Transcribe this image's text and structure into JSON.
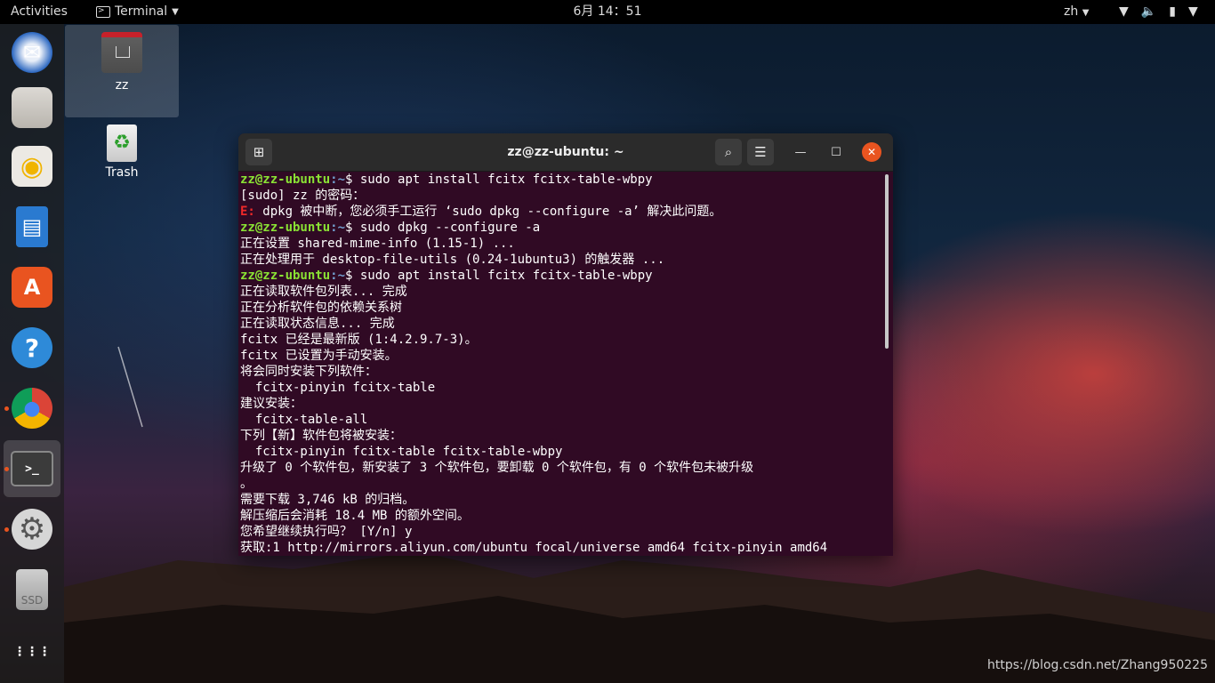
{
  "topbar": {
    "activities": "Activities",
    "app_menu": "Terminal",
    "clock": "6月 14：51",
    "language": "zh"
  },
  "desktop": {
    "home_label": "zz",
    "trash_label": "Trash"
  },
  "dock": {
    "items": [
      {
        "name": "thunderbird",
        "glyph": "✉"
      },
      {
        "name": "files",
        "glyph": ""
      },
      {
        "name": "rhythmbox",
        "glyph": "◉"
      },
      {
        "name": "writer",
        "glyph": "▤"
      },
      {
        "name": "software",
        "glyph": "A"
      },
      {
        "name": "help",
        "glyph": "?"
      },
      {
        "name": "chrome",
        "glyph": "●"
      },
      {
        "name": "terminal",
        "glyph": ">_"
      },
      {
        "name": "settings",
        "glyph": "⚙"
      },
      {
        "name": "ssd",
        "glyph": "SSD"
      },
      {
        "name": "app-grid",
        "glyph": "⋮⋮⋮"
      }
    ]
  },
  "terminal": {
    "title": "zz@zz-ubuntu: ~",
    "lines": [
      {
        "kind": "prompt",
        "user": "zz@zz-ubuntu",
        "path": ":~",
        "cmd": "$ sudo apt install fcitx fcitx-table-wbpy"
      },
      {
        "kind": "text",
        "text": "[sudo] zz 的密码："
      },
      {
        "kind": "error",
        "label": "E:",
        "text": " dpkg 被中断，您必须手工运行 ‘sudo dpkg --configure -a’ 解决此问题。"
      },
      {
        "kind": "prompt",
        "user": "zz@zz-ubuntu",
        "path": ":~",
        "cmd": "$ sudo dpkg --configure -a"
      },
      {
        "kind": "text",
        "text": "正在设置 shared-mime-info (1.15-1) ..."
      },
      {
        "kind": "text",
        "text": "正在处理用于 desktop-file-utils (0.24-1ubuntu3) 的触发器 ..."
      },
      {
        "kind": "prompt",
        "user": "zz@zz-ubuntu",
        "path": ":~",
        "cmd": "$ sudo apt install fcitx fcitx-table-wbpy"
      },
      {
        "kind": "text",
        "text": "正在读取软件包列表... 完成"
      },
      {
        "kind": "text",
        "text": "正在分析软件包的依赖关系树"
      },
      {
        "kind": "text",
        "text": "正在读取状态信息... 完成"
      },
      {
        "kind": "text",
        "text": "fcitx 已经是最新版 (1:4.2.9.7-3)。"
      },
      {
        "kind": "text",
        "text": "fcitx 已设置为手动安装。"
      },
      {
        "kind": "text",
        "text": "将会同时安装下列软件："
      },
      {
        "kind": "text",
        "text": "  fcitx-pinyin fcitx-table"
      },
      {
        "kind": "text",
        "text": "建议安装："
      },
      {
        "kind": "text",
        "text": "  fcitx-table-all"
      },
      {
        "kind": "text",
        "text": "下列【新】软件包将被安装："
      },
      {
        "kind": "text",
        "text": "  fcitx-pinyin fcitx-table fcitx-table-wbpy"
      },
      {
        "kind": "text",
        "text": "升级了 0 个软件包，新安装了 3 个软件包，要卸载 0 个软件包，有 0 个软件包未被升级"
      },
      {
        "kind": "text",
        "text": "。"
      },
      {
        "kind": "text",
        "text": "需要下载 3,746 kB 的归档。"
      },
      {
        "kind": "text",
        "text": "解压缩后会消耗 18.4 MB 的额外空间。"
      },
      {
        "kind": "text",
        "text": "您希望继续执行吗？ [Y/n] y"
      },
      {
        "kind": "text",
        "text": "获取:1 http://mirrors.aliyun.com/ubuntu focal/universe amd64 fcitx-pinyin amd64"
      }
    ]
  },
  "watermark": "https://blog.csdn.net/Zhang950225"
}
